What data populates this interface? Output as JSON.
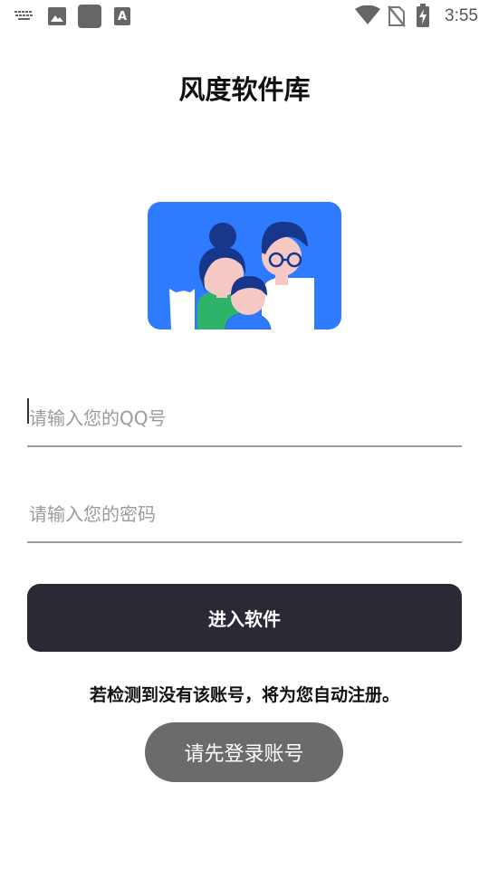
{
  "status_bar": {
    "time": "3:55",
    "icons": [
      "keyboard-icon",
      "image-icon",
      "app-square-icon",
      "text-a-icon",
      "wifi-icon",
      "no-sim-icon",
      "battery-charging-icon"
    ]
  },
  "app": {
    "title": "风度软件库"
  },
  "form": {
    "qq_placeholder": "请输入您的QQ号",
    "qq_value": "",
    "password_placeholder": "请输入您的密码",
    "password_value": ""
  },
  "buttons": {
    "enter_label": "进入软件",
    "login_label": "请先登录账号"
  },
  "notice": "若检测到没有该账号，将为您自动注册。",
  "colors": {
    "primary_button": "#2a2a35",
    "secondary_button": "#6b6b6b",
    "illustration_bg": "#2f7bff"
  }
}
